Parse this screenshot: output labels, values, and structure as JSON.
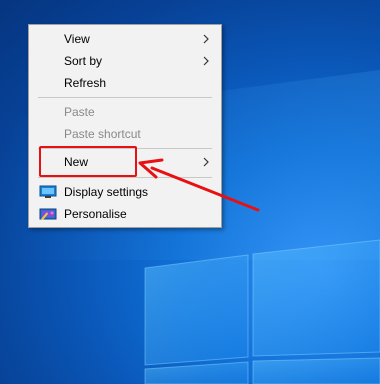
{
  "context_menu": {
    "items": [
      {
        "label": "View",
        "enabled": true,
        "has_submenu": true
      },
      {
        "label": "Sort by",
        "enabled": true,
        "has_submenu": true
      },
      {
        "label": "Refresh",
        "enabled": true,
        "has_submenu": false
      },
      {
        "label": "Paste",
        "enabled": false,
        "has_submenu": false
      },
      {
        "label": "Paste shortcut",
        "enabled": false,
        "has_submenu": false
      },
      {
        "label": "New",
        "enabled": true,
        "has_submenu": true
      },
      {
        "label": "Display settings",
        "enabled": true,
        "has_submenu": false,
        "icon": "display-settings-icon"
      },
      {
        "label": "Personalise",
        "enabled": true,
        "has_submenu": false,
        "icon": "personalise-icon"
      }
    ]
  },
  "annotation": {
    "highlighted_item": "New",
    "color": "#e81010"
  },
  "theme": {
    "desktop_blue": "#0a56b6",
    "menu_background": "#f2f2f2",
    "disabled_text": "#8a8a8a"
  }
}
